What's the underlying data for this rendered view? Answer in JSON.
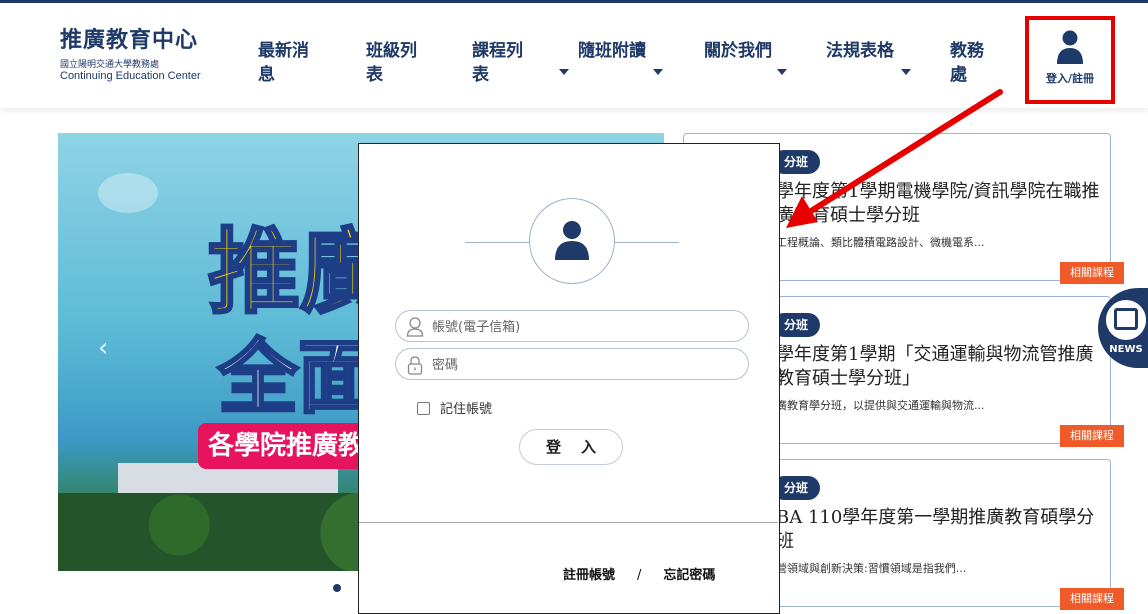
{
  "logo": {
    "title": "推廣教育中心",
    "subtitle_cn": "國立陽明交通大學教務處",
    "subtitle_en": "Continuing Education Center"
  },
  "nav": {
    "items": [
      {
        "label": "最新消息",
        "has_dropdown": false
      },
      {
        "label": "班級列表",
        "has_dropdown": false
      },
      {
        "label": "課程列表",
        "has_dropdown": true
      },
      {
        "label": "隨班附讀",
        "has_dropdown": true
      },
      {
        "label": "關於我們",
        "has_dropdown": true
      },
      {
        "label": "法規表格",
        "has_dropdown": true
      },
      {
        "label": "教務處",
        "has_dropdown": false
      }
    ],
    "login_label": "登入/註冊",
    "login_icon": "user-icon"
  },
  "banner": {
    "line1": "推廣",
    "line2": "全面",
    "strip": "各學院推廣教",
    "prev_icon": "chevron-left-icon"
  },
  "cards": [
    {
      "tag": "分班",
      "title": "學年度第1學期電機學院/資訊學院在職推廣教育碩士學分班",
      "desc": "工程概論、類比體積電路設計、微機電系...",
      "related": "相關課程"
    },
    {
      "tag": "分班",
      "title": "學年度第1學期「交通運輸與物流管推廣教育碩士學分班」",
      "desc": "廣教育學分班，以提供與交通運輸與物流...",
      "related": "相關課程"
    },
    {
      "tag": "分班",
      "title": "BA 110學年度第一學期推廣教育碩學分班",
      "desc": "營領域與創新決策:習慣領域是指我們...",
      "related": "相關課程"
    }
  ],
  "news_tab": {
    "label": "NEWS",
    "icon": "newspaper-icon"
  },
  "login_modal": {
    "avatar_icon": "user-icon",
    "account_placeholder": "帳號(電子信箱)",
    "password_placeholder": "密碼",
    "remember_label": "記住帳號",
    "submit_label": "登入",
    "register_link": "註冊帳號",
    "separator": "/",
    "forgot_link": "忘記密碼"
  },
  "colors": {
    "brand": "#1f3a68",
    "accent": "#f05a28",
    "highlight": "#e60000"
  }
}
